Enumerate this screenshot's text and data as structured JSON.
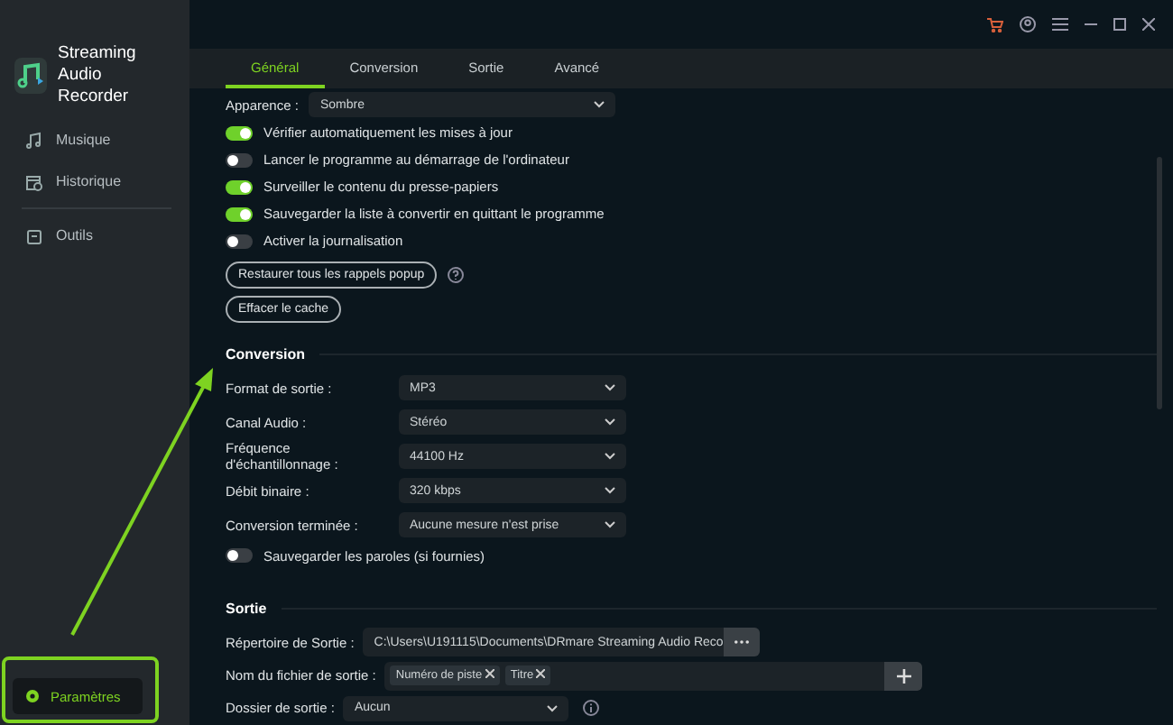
{
  "window": {
    "app_name": "Streaming Audio Recorder"
  },
  "sidebar": {
    "items": [
      {
        "label": "Musique",
        "kind": "music"
      },
      {
        "label": "Historique",
        "kind": "history"
      },
      {
        "label": "Outils",
        "kind": "tools"
      }
    ],
    "settings_button": "Paramètres"
  },
  "tabs": [
    {
      "label": "Général",
      "selected": true
    },
    {
      "label": "Conversion",
      "selected": false
    },
    {
      "label": "Sortie",
      "selected": false
    },
    {
      "label": "Avancé",
      "selected": false
    }
  ],
  "general": {
    "appearance": {
      "label": "Apparence :",
      "value": "Sombre"
    },
    "toggles": [
      {
        "label": "Vérifier automatiquement les mises à jour",
        "on": true
      },
      {
        "label": "Lancer le programme au démarrage de l'ordinateur",
        "on": false
      },
      {
        "label": "Surveiller le contenu du presse-papiers",
        "on": true
      },
      {
        "label": "Sauvegarder la liste à convertir en quittant le programme",
        "on": true
      },
      {
        "label": "Activer la journalisation",
        "on": false
      }
    ],
    "buttons": [
      {
        "label": "Restaurer tous les rappels popup",
        "help": true
      },
      {
        "label": "Effacer le cache",
        "help": false
      }
    ]
  },
  "conversion": {
    "title": "Conversion",
    "settings": [
      {
        "label": "Format de sortie :",
        "value": "MP3"
      },
      {
        "label": "Canal Audio :",
        "value": "Stéréo"
      },
      {
        "label": "Fréquence d'échantillonnage :",
        "value": "44100 Hz"
      },
      {
        "label": "Débit binaire :",
        "value": "320 kbps"
      },
      {
        "label": "Conversion terminée :",
        "value": "Aucune mesure n'est prise"
      }
    ],
    "toggle": {
      "label": "Sauvegarder les paroles (si fournies)",
      "on": false
    }
  },
  "output": {
    "title": "Sortie",
    "directory": {
      "label": "Répertoire de Sortie :",
      "value": "C:\\Users\\U191115\\Documents\\DRmare Streaming Audio Reco"
    },
    "filename": {
      "label": "Nom du fichier de sortie :",
      "tags": [
        "Numéro de piste",
        "Titre"
      ]
    },
    "folder": {
      "label": "Dossier de sortie :",
      "value": "Aucun"
    }
  }
}
